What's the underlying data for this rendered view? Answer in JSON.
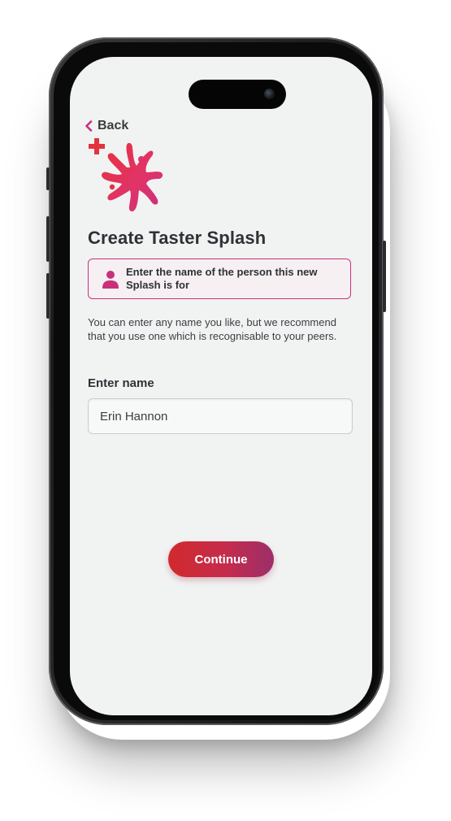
{
  "header": {
    "back_label": "Back"
  },
  "page": {
    "title": "Create Taster Splash"
  },
  "info_box": {
    "text": "Enter the name of the person this new Splash is for"
  },
  "description": "You can enter any name you like, but we recommend that you use one which is recognisable to your peers.",
  "name_field": {
    "label": "Enter name",
    "value": "Erin Hannon"
  },
  "continue_button": {
    "label": "Continue"
  },
  "icons": {
    "back": "chevron-left-icon",
    "logo": "splash-plus-logo",
    "person": "person-icon"
  },
  "colors": {
    "accent_pink": "#c9307a",
    "button_start": "#d12a2e",
    "button_end": "#9c2e6a",
    "screen_bg": "#f1f3f3"
  }
}
